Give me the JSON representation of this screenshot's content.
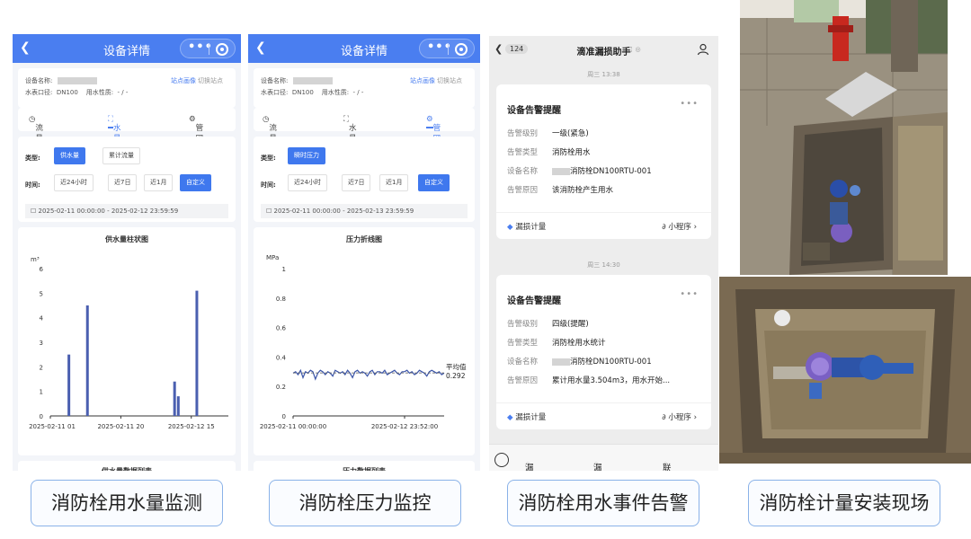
{
  "panels": {
    "flow": {
      "title": "设备详情",
      "device_name_label": "设备名称:",
      "site_image_link": "站点画像",
      "switch_site_link": "切换站点",
      "caliber_label": "水表口径:",
      "caliber_value": "DN100",
      "water_type_label": "用水性质:",
      "water_type_value": "- / -",
      "tabs": [
        "流量分析",
        "水量分析",
        "管网压力"
      ],
      "type_label": "类型:",
      "type_options": [
        "供水量",
        "累计流量"
      ],
      "time_label": "时间:",
      "time_options": [
        "近24小时",
        "近7日",
        "近1月",
        "自定义"
      ],
      "date_range": "2025-02-11 00:00:00 - 2025-02-12 23:59:59",
      "list_title": "供水量数据列表"
    },
    "pressure": {
      "title": "设备详情",
      "device_name_label": "设备名称:",
      "site_image_link": "站点画像",
      "switch_site_link": "切换站点",
      "caliber_label": "水表口径:",
      "caliber_value": "DN100",
      "water_type_label": "用水性质:",
      "water_type_value": "- / -",
      "tabs": [
        "流量分析",
        "水量分析",
        "管网压力"
      ],
      "type_label": "类型:",
      "type_options": [
        "瞬时压力"
      ],
      "time_label": "时间:",
      "time_options": [
        "近24小时",
        "近7日",
        "近1月",
        "自定义"
      ],
      "date_range": "2025-02-11 00:00:00 - 2025-02-13 23:59:59",
      "list_title": "压力数据列表"
    },
    "chat": {
      "unread": "124",
      "title": "滴准漏损助手",
      "messages": [
        {
          "time": "周三 13:38",
          "heading": "设备告警提醒",
          "rows": [
            {
              "k": "告警级别",
              "v": "一级(紧急)"
            },
            {
              "k": "告警类型",
              "v": "消防栓用水"
            },
            {
              "k": "设备名称",
              "v": "消防栓DN100RTU-001"
            },
            {
              "k": "告警原因",
              "v": "该消防栓产生用水"
            }
          ],
          "source": "漏损计量",
          "app": "小程序"
        },
        {
          "time": "周三 14:30",
          "heading": "设备告警提醒",
          "rows": [
            {
              "k": "告警级别",
              "v": "四级(提醒)"
            },
            {
              "k": "告警类型",
              "v": "消防栓用水统计"
            },
            {
              "k": "设备名称",
              "v": "消防栓DN100RTU-001"
            },
            {
              "k": "告警原因",
              "v": "累计用水量3.504m3，用水开始..."
            }
          ],
          "source": "漏损计量",
          "app": "小程序"
        }
      ],
      "bottom_menu": [
        "漏损计量",
        "漏损智诊",
        "联系我们"
      ]
    }
  },
  "captions": [
    "消防栓用水量监测",
    "消防栓压力监控",
    "消防栓用水事件告警",
    "消防栓计量安装现场"
  ],
  "chart_data": [
    {
      "type": "bar",
      "title": "供水量柱状图",
      "ylabel": "m³",
      "ylim": [
        0,
        6
      ],
      "yticks": [
        "0",
        "1",
        "2",
        "3",
        "4",
        "5",
        "6"
      ],
      "xticks": [
        "2025-02-11 01",
        "2025-02-11 20",
        "2025-02-12 15"
      ],
      "x_range_hours": [
        0,
        48
      ],
      "bars": [
        {
          "hour": 5,
          "value": 2.5
        },
        {
          "hour": 10,
          "value": 4.5
        },
        {
          "hour": 33.5,
          "value": 1.4
        },
        {
          "hour": 34.5,
          "value": 0.8
        },
        {
          "hour": 39.5,
          "value": 5.1
        }
      ]
    },
    {
      "type": "line",
      "title": "压力折线图",
      "ylabel": "MPa",
      "ylim": [
        0,
        1
      ],
      "yticks": [
        "0",
        "0.2",
        "0.4",
        "0.6",
        "0.8",
        "1"
      ],
      "xticks": [
        "2025-02-11 00:00:00",
        "2025-02-12 23:52:00"
      ],
      "avg_label": "平均值",
      "avg_value": "0.292",
      "series": [
        {
          "values": [
            0.29,
            0.3,
            0.28,
            0.31,
            0.26,
            0.3,
            0.29,
            0.31,
            0.3,
            0.25,
            0.29,
            0.31,
            0.3,
            0.28,
            0.3,
            0.29,
            0.27,
            0.31,
            0.3,
            0.29,
            0.3,
            0.28,
            0.31,
            0.29,
            0.26,
            0.3,
            0.31,
            0.29,
            0.3,
            0.29,
            0.27,
            0.3,
            0.31,
            0.28,
            0.3,
            0.3,
            0.29,
            0.31,
            0.28,
            0.29,
            0.3,
            0.31,
            0.29,
            0.28,
            0.3,
            0.3,
            0.31,
            0.29,
            0.3,
            0.28,
            0.29,
            0.31,
            0.3,
            0.29,
            0.27,
            0.3,
            0.31,
            0.3,
            0.29,
            0.3,
            0.28,
            0.29
          ]
        }
      ]
    }
  ]
}
